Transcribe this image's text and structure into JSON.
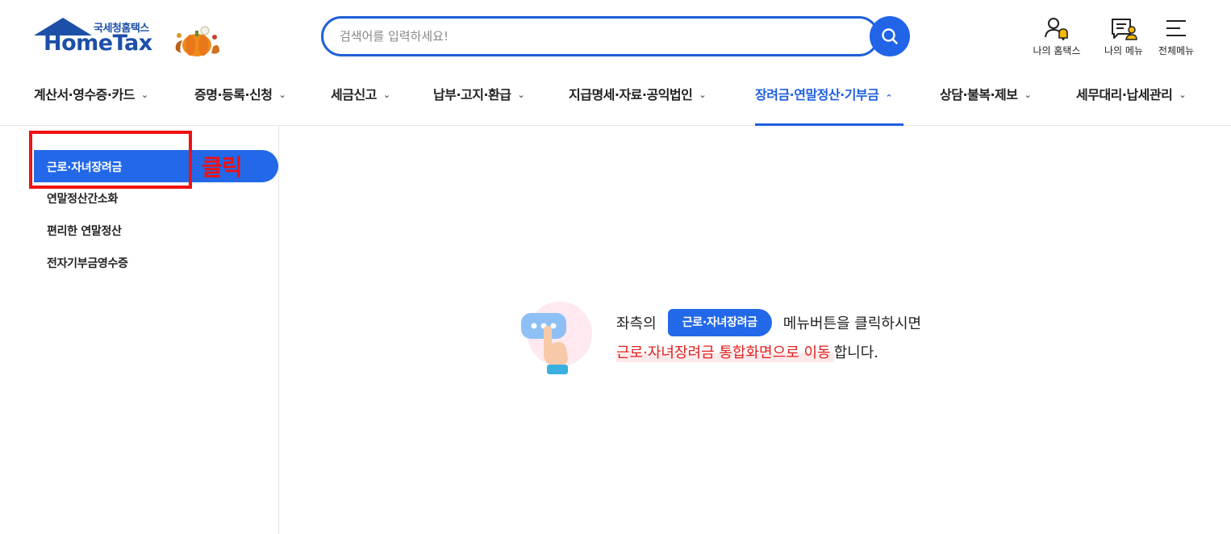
{
  "header": {
    "logo_ko": "국세청홈택스",
    "logo_en": "HomeTax",
    "search_placeholder": "검색어를 입력하세요!",
    "util": [
      {
        "label": "나의 홈택스",
        "icon": "user-bell-icon"
      },
      {
        "label": "나의 메뉴",
        "icon": "my-menu-icon"
      },
      {
        "label": "전체메뉴",
        "icon": "hamburger-icon"
      }
    ]
  },
  "nav": {
    "items": [
      {
        "label": "계산서·영수증·카드",
        "active": false
      },
      {
        "label": "증명·등록·신청",
        "active": false
      },
      {
        "label": "세금신고",
        "active": false
      },
      {
        "label": "납부·고지·환급",
        "active": false
      },
      {
        "label": "지급명세·자료·공익법인",
        "active": false
      },
      {
        "label": "장려금·연말정산·기부금",
        "active": true
      },
      {
        "label": "상담·불복·제보",
        "active": false
      },
      {
        "label": "세무대리·납세관리",
        "active": false
      }
    ]
  },
  "sidebar": {
    "items": [
      {
        "label": "근로·자녀장려금",
        "active": true
      },
      {
        "label": "연말정산간소화",
        "active": false
      },
      {
        "label": "편리한 연말정산",
        "active": false
      },
      {
        "label": "전자기부금영수증",
        "active": false
      }
    ],
    "annotation": "클릭"
  },
  "main": {
    "line1_before": "좌측의",
    "chip": "근로·자녀장려금",
    "line1_after": "메뉴버튼을 클릭하시면",
    "line2_highlight": "근로·자녀장려금 통합화면으로 이동",
    "line2_after": "합니다."
  },
  "colors": {
    "brand": "#1c4fa8",
    "accent": "#2268e8",
    "annotation": "#ee1111",
    "highlight_text": "#e0201e"
  }
}
